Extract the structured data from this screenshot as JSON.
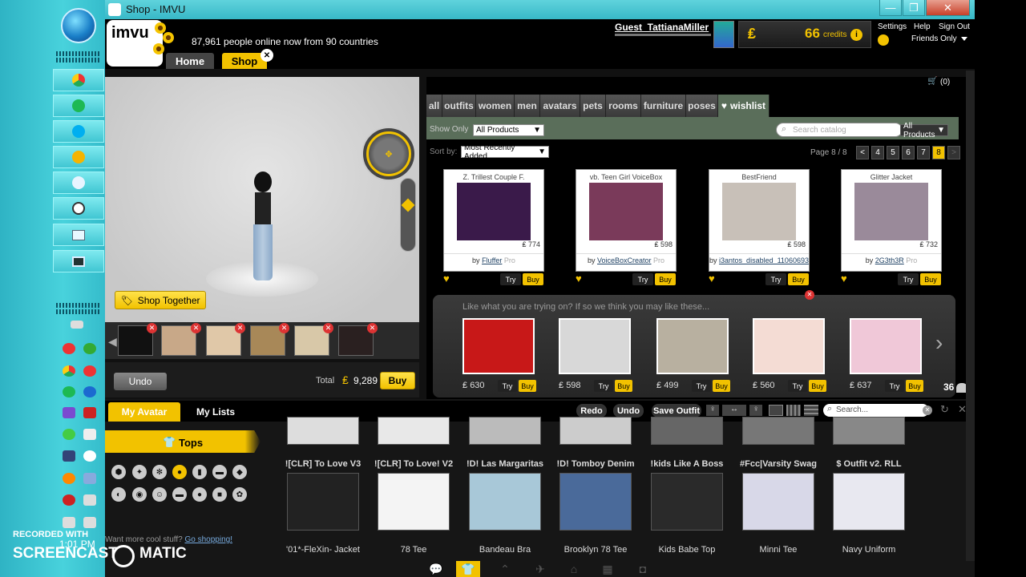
{
  "window": {
    "title": "Shop - IMVU",
    "minimize": "—",
    "maximize": "❐",
    "close": "✕"
  },
  "header": {
    "online_text": "87,961 people online now from 90 countries",
    "username": "Guest_TattianaMiller",
    "credits_value": "66",
    "credits_label": "credits",
    "settings": "Settings",
    "help": "Help",
    "signout": "Sign Out",
    "friends_only": "Friends Only",
    "logo_text": "imvu"
  },
  "nav": {
    "home": "Home",
    "shop": "Shop",
    "close": "✕"
  },
  "cart": {
    "label": "(0)"
  },
  "categories": [
    "all",
    "outfits",
    "women",
    "men",
    "avatars",
    "pets",
    "rooms",
    "furniture",
    "poses"
  ],
  "wishlist_label": "wishlist",
  "filters": {
    "show_only_label": "Show Only",
    "show_only_value": "All Products",
    "sort_label": "Sort by:",
    "sort_value": "Most Recently Added",
    "search_placeholder": "Search catalog",
    "search_scope": "All Products",
    "page_info": "Page 8 / 8",
    "pages": [
      "<",
      "4",
      "5",
      "6",
      "7",
      "8",
      ">"
    ]
  },
  "products": [
    {
      "title": "Z. Trillest Couple F.",
      "price": "774",
      "creator": "Fluffer",
      "badge": "Pro",
      "thumb_color": "#3a1a4a"
    },
    {
      "title": "vb. Teen Girl VoiceBox",
      "price": "598",
      "creator": "VoiceBoxCreator",
      "badge": "Pro",
      "thumb_color": "#7a3a5a"
    },
    {
      "title": "BestFriend",
      "price": "598",
      "creator": "i3antos_disabled_11060693",
      "badge": "",
      "thumb_color": "#c8c0b8"
    },
    {
      "title": "Glitter Jacket",
      "price": "732",
      "creator": "2G3th3R",
      "badge": "Pro",
      "thumb_color": "#9a8a9a"
    }
  ],
  "try_label": "Try",
  "buy_label": "Buy",
  "recommend": {
    "text": "Like what you are trying on? If so we think you may like these...",
    "items": [
      {
        "price": "630",
        "color": "#c81818"
      },
      {
        "price": "598",
        "color": "#d8d8d8"
      },
      {
        "price": "499",
        "color": "#b8b0a0"
      },
      {
        "price": "560",
        "color": "#f4dcd4"
      },
      {
        "price": "637",
        "color": "#f0c8d8"
      }
    ]
  },
  "avatar_panel": {
    "shop_together": "Shop Together",
    "undo": "Undo",
    "total_label": "Total",
    "total_value": "9,289",
    "buy": "Buy"
  },
  "bottom": {
    "tab_my_avatar": "My Avatar",
    "tab_my_lists": "My Lists",
    "redo": "Redo",
    "undo": "Undo",
    "save_outfit": "Save Outfit",
    "search_placeholder": "Search...",
    "category": "Tops",
    "more_stuff": "Want more cool stuff?",
    "go_shopping": "Go shopping!",
    "online_count": "36",
    "items_row1": [
      {
        "name": "![CLR] To Love V3",
        "color": "#222"
      },
      {
        "name": "![CLR] To Love! V2",
        "color": "#f4f4f4"
      },
      {
        "name": "!D! Las Margaritas",
        "color": "#a8c8d8"
      },
      {
        "name": "!D! Tomboy Denim",
        "color": "#4a6a9a"
      },
      {
        "name": "!kids Like A Boss",
        "color": "#2a2a2a"
      },
      {
        "name": "#Fcc|Varsity Swag",
        "color": "#d8d8e8"
      },
      {
        "name": "$ Outfit v2. RLL",
        "color": "#e8e8f0"
      }
    ],
    "items_row2": [
      "'01*-FleXin- Jacket",
      "78 Tee",
      "Bandeau Bra",
      "Brooklyn 78 Tee",
      "Kids Babe Top",
      "Minni Tee",
      "Navy Uniform"
    ]
  },
  "watermark": {
    "line1": "RECORDED WITH",
    "line2": "SCREENCAST",
    "line3": "MATIC",
    "clock": "1:01 PM"
  },
  "colors": {
    "accent": "#f2c200",
    "teal": "#3fc2cf",
    "shop_tab": "#f2c200"
  }
}
